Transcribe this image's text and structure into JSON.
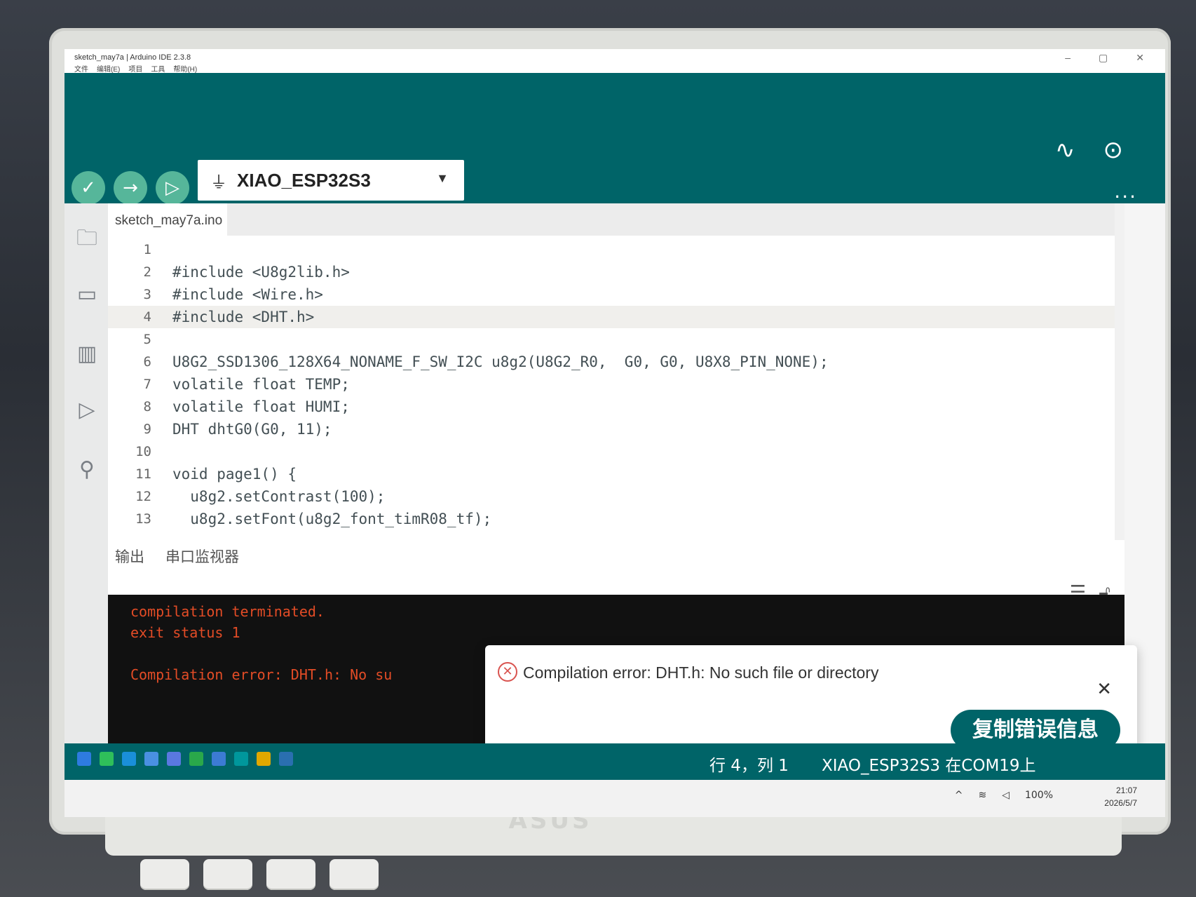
{
  "window": {
    "title": "sketch_may7a | Arduino IDE 2.3.8",
    "menu": [
      "文件",
      "编辑(E)",
      "项目",
      "工具",
      "帮助(H)"
    ],
    "controls": [
      "–",
      "▢",
      "✕"
    ]
  },
  "toolbar": {
    "verify_icon": "checkmark-icon",
    "upload_icon": "arrow-right-icon",
    "debug_icon": "debug-icon",
    "board": "XIAO_ESP32S3",
    "board_icon": "usb-icon",
    "serial_plotter_icon": "plotter-icon",
    "serial_monitor_icon": "monitor-icon",
    "more": "···"
  },
  "sidebar": {
    "icons": [
      "folder-icon",
      "board-manager-icon",
      "library-icon",
      "debug-icon",
      "search-icon",
      "avatar"
    ]
  },
  "editor": {
    "file_tab": "sketch_may7a.ino",
    "lines": [
      {
        "n": "1",
        "text": ""
      },
      {
        "n": "2",
        "text": "#include <U8g2lib.h>"
      },
      {
        "n": "3",
        "text": "#include <Wire.h>"
      },
      {
        "n": "4",
        "text": "#include <DHT.h>"
      },
      {
        "n": "5",
        "text": ""
      },
      {
        "n": "6",
        "text": "U8G2_SSD1306_128X64_NONAME_F_SW_I2C u8g2(U8G2_R0,  G0, G0, U8X8_PIN_NONE);"
      },
      {
        "n": "7",
        "text": "volatile float TEMP;"
      },
      {
        "n": "8",
        "text": "volatile float HUMI;"
      },
      {
        "n": "9",
        "text": "DHT dhtG0(G0, 11);"
      },
      {
        "n": "10",
        "text": ""
      },
      {
        "n": "11",
        "text": "void page1() {"
      },
      {
        "n": "12",
        "text": "  u8g2.setContrast(100);"
      },
      {
        "n": "13",
        "text": "  u8g2.setFont(u8g2_font_timR08_tf);"
      }
    ]
  },
  "panel": {
    "tabs": [
      "输出",
      "串口监视器"
    ],
    "console": [
      "compilation terminated.",
      "exit status 1",
      "",
      "Compilation error: DHT.h: No su"
    ]
  },
  "toast": {
    "message": "Compilation error: DHT.h: No such file or directory",
    "close": "✕",
    "copy_button": "复制错误信息"
  },
  "statusbar": {
    "position": "行 4，列 1",
    "board_port": "XIAO_ESP32S3 在COM19上"
  },
  "systray": {
    "battery": "100%",
    "time": "21:07",
    "date": "2026/5/7"
  },
  "colors": {
    "teal": "#006468",
    "accent": "#56b69a",
    "error": "#e34c26"
  }
}
